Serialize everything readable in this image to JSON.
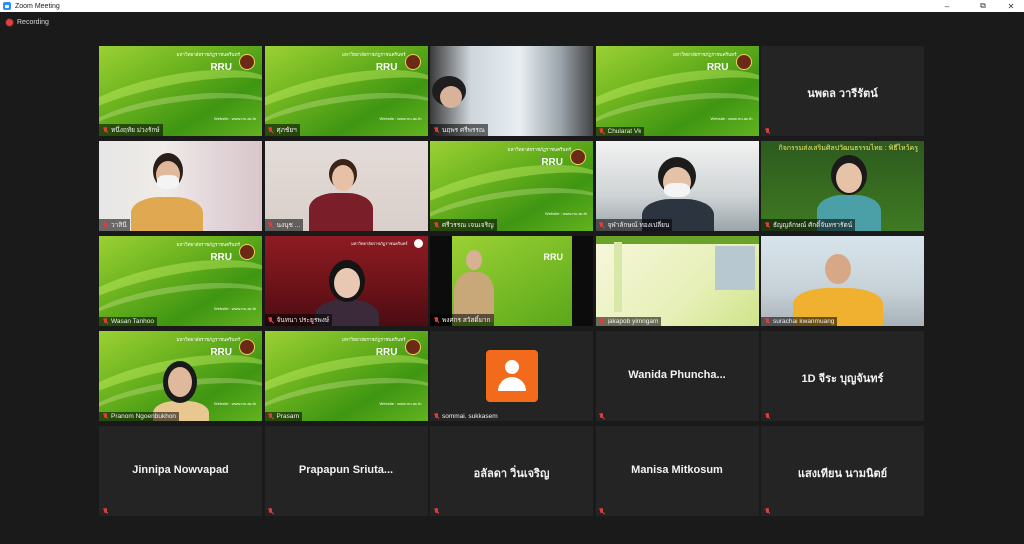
{
  "window": {
    "title": "Zoom Meeting",
    "minimize": "–",
    "maximize": "⧉",
    "close": "✕"
  },
  "recording": {
    "label": "Recording"
  },
  "brand": {
    "rru_text": "RRU",
    "rru_uni": "มหาวิทยาลัยราชภัฏราชนครินทร์",
    "rru_web": "Website : www.rru.ac.th",
    "red_banner": "มหาวิทยาลัยราชภัฏราชนครินทร์",
    "green_banner": "กิจกรรมส่งเสริมศิลปวัฒนธรรมไทย : พิธีไหว้ครู"
  },
  "tiles": [
    {
      "name": "หนึ่งฤทัย ม่วงรักษ์"
    },
    {
      "name": "ศุภชัยฯ"
    },
    {
      "name": "นฤพร ศรีพรรณ"
    },
    {
      "name": "Chularat Vk"
    },
    {
      "name": "นพดล วารีรัตน์"
    },
    {
      "name": "วาสินี"
    },
    {
      "name": "นงนุช ... "
    },
    {
      "name": "ศรีวรรณ เจนเจริญ"
    },
    {
      "name": "จุฬาลักษณ์ ทองเปลี่ยน"
    },
    {
      "name": "ธัญญลักษณ์ ศักดิ์จันทรารัตน์"
    },
    {
      "name": "Wasan Tanhoo"
    },
    {
      "name": "จันทนา ประยูรพงษ์"
    },
    {
      "name": "พงศกร สวัสดิ์มาก"
    },
    {
      "name": "jakapob yimngam"
    },
    {
      "name": "surachai kwanmuang"
    },
    {
      "name": "Pranom Ngoenbukhon"
    },
    {
      "name": "Prasarn"
    },
    {
      "name": "sommai. sukkasem"
    },
    {
      "name": "Wanida  Phuncha..."
    },
    {
      "name": "1D จีระ  บุญจันทร์"
    },
    {
      "name": "Jinnipa Nowvapad"
    },
    {
      "name": "Prapapun  Sriuta..."
    },
    {
      "name": "อลัลดา  วิ่นเจริญ"
    },
    {
      "name": "Manisa Mitkosum"
    },
    {
      "name": "แสงเทียน นามนิตย์"
    }
  ],
  "colors": {
    "accent_active": "#c9e05a",
    "mic_muted": "#e03c3c",
    "avatar": "#f26b1d",
    "rru_green": "#6fb520"
  }
}
